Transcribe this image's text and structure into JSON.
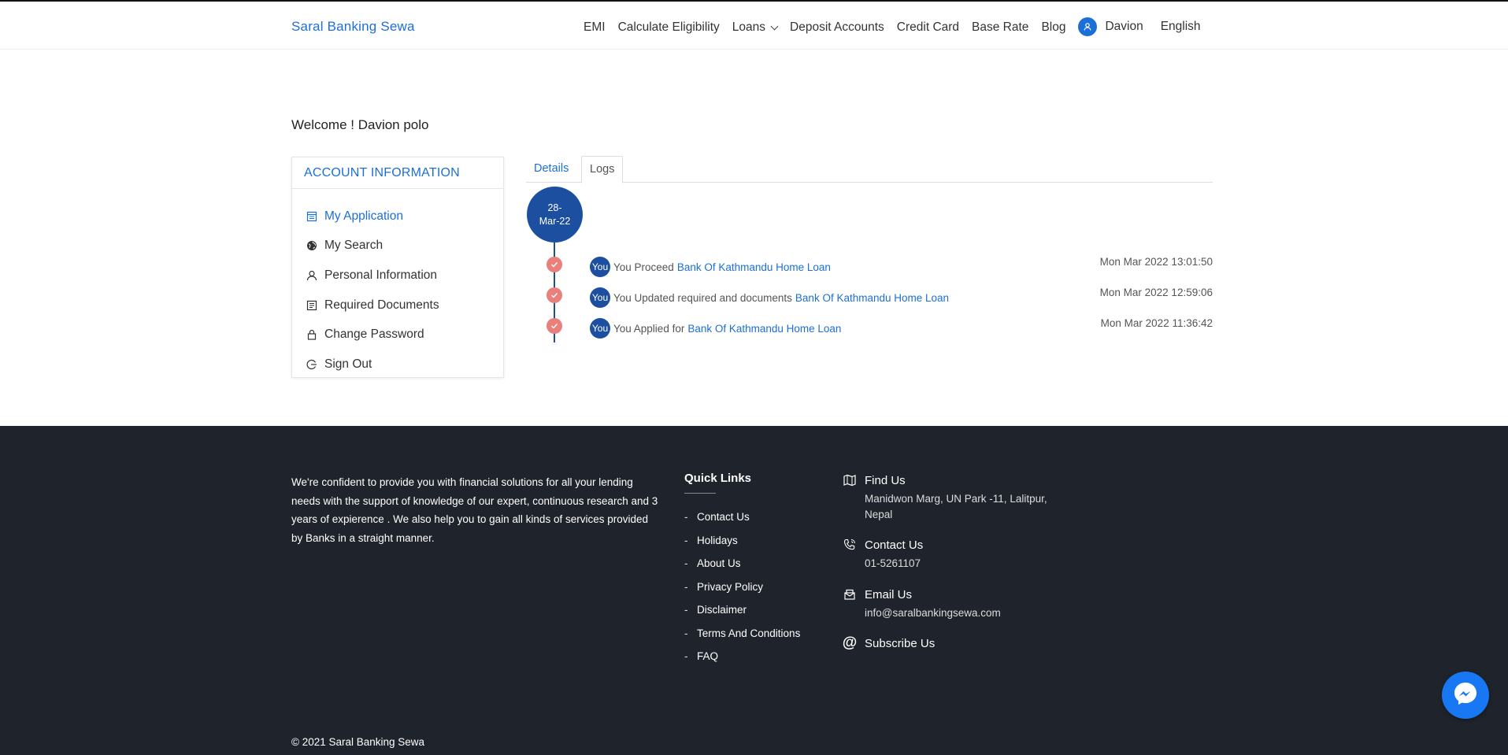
{
  "header": {
    "brand": "Saral Banking Sewa",
    "nav": [
      "EMI",
      "Calculate Eligibility",
      "Loans",
      "Deposit Accounts",
      "Credit Card",
      "Base Rate",
      "Blog"
    ],
    "user_name": "Davion",
    "language": "English"
  },
  "welcome": "Welcome ! Davion polo",
  "sidebar": {
    "title": "ACCOUNT INFORMATION",
    "items": [
      {
        "label": "My Application",
        "icon": "application-icon"
      },
      {
        "label": "My Search",
        "icon": "globe-icon"
      },
      {
        "label": "Personal Information",
        "icon": "user-icon"
      },
      {
        "label": "Required Documents",
        "icon": "document-icon"
      },
      {
        "label": "Change Password",
        "icon": "lock-icon"
      },
      {
        "label": "Sign Out",
        "icon": "sign-out-icon"
      }
    ]
  },
  "tabs": {
    "details": "Details",
    "logs": "Logs"
  },
  "timeline": {
    "date_line1": "28-",
    "date_line2": "Mar-22",
    "logs": [
      {
        "you": "You",
        "text": "You Proceed",
        "link": "Bank Of Kathmandu Home Loan",
        "time": "Mon Mar 2022 13:01:50"
      },
      {
        "you": "You",
        "text": "You Updated required and documents",
        "link": "Bank Of Kathmandu Home Loan",
        "time": "Mon Mar 2022 12:59:06"
      },
      {
        "you": "You",
        "text": "You Applied for",
        "link": "Bank Of Kathmandu Home Loan",
        "time": "Mon Mar 2022 11:36:42"
      }
    ]
  },
  "footer": {
    "about": "We're confident to provide you with financial solutions for all your lending needs with the support of knowledge of our expert, continuous research and 3 years of expierence . We also help you to gain all kinds of services provided by Banks in a straight manner.",
    "quick_links_title": "Quick Links",
    "quick_links": [
      "Contact Us",
      "Holidays",
      "About Us",
      "Privacy Policy",
      "Disclaimer",
      "Terms And Conditions",
      "FAQ"
    ],
    "find_us_title": "Find Us",
    "find_us_line1": "Manidwon Marg, UN Park -11, Lalitpur,",
    "find_us_line2": "Nepal",
    "contact_title": "Contact Us",
    "contact_phone": "01-5261107",
    "email_title": "Email Us",
    "email": "info@saralbankingsewa.com",
    "subscribe_title": "Subscribe Us",
    "copyright": "© 2021 Saral Banking Sewa"
  },
  "colors": {
    "brand": "#1c6fd6",
    "timeline": "#1c4fa0",
    "check": "#e9807b",
    "footer_bg": "#1f232b",
    "messenger": "#1877f2"
  }
}
